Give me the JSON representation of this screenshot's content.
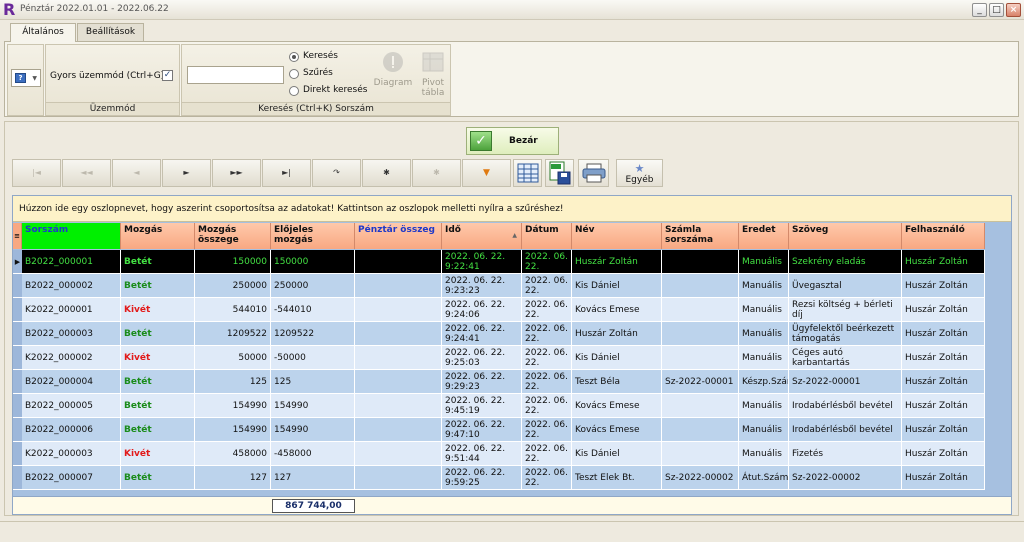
{
  "window": {
    "title": "Pénztár 2022.01.01 - 2022.06.22",
    "logo": "R"
  },
  "tabs": [
    {
      "label": "Általános",
      "active": true
    },
    {
      "label": "Beállítások",
      "active": false
    }
  ],
  "ribbon": {
    "mode_group": {
      "fast_mode_label": "Gyors üzemmód (Ctrl+G)",
      "fast_mode_checked": true,
      "caption": "Üzemmód"
    },
    "search_group": {
      "caption": "Keresés (Ctrl+K) Sorszám",
      "search_value": "",
      "options": [
        "Keresés",
        "Szűrés",
        "Direkt keresés"
      ],
      "selected_option": "Keresés",
      "diagram_label": "Diagram",
      "pivot_label_1": "Pivot",
      "pivot_label_2": "tábla"
    }
  },
  "close_button": {
    "label": "Bezár"
  },
  "toolbar": {
    "other_label": "Egyéb"
  },
  "grid": {
    "group_hint": "Húzzon ide egy oszlopnevet, hogy aszerint csoportosítsa az adatokat! Kattintson az oszlopok melletti nyílra a szűréshez!",
    "headers": [
      "Sorszám",
      "Mozgás",
      "Mozgás összege",
      "Előjeles mozgás",
      "Pénztár összeg",
      "Idő",
      "Dátum",
      "Név",
      "Számla sorszáma",
      "Eredet",
      "Szöveg",
      "Felhasználó"
    ],
    "rows": [
      {
        "sorszam": "B2022_000001",
        "mozgas": "Betét",
        "osszeg": "150000",
        "elojeles": "150000",
        "penztar": "",
        "ido": "2022. 06. 22. 9:22:41",
        "datum": "2022. 06. 22.",
        "nev": "Huszár Zoltán",
        "szamla": "",
        "eredet": "Manuális",
        "szoveg": "Szekrény eladás",
        "felhasznalo": "Huszár Zoltán"
      },
      {
        "sorszam": "B2022_000002",
        "mozgas": "Betét",
        "osszeg": "250000",
        "elojeles": "250000",
        "penztar": "",
        "ido": "2022. 06. 22. 9:23:23",
        "datum": "2022. 06. 22.",
        "nev": "Kis Dániel",
        "szamla": "",
        "eredet": "Manuális",
        "szoveg": "Üvegasztal",
        "felhasznalo": "Huszár Zoltán"
      },
      {
        "sorszam": "K2022_000001",
        "mozgas": "Kivét",
        "osszeg": "544010",
        "elojeles": "-544010",
        "penztar": "",
        "ido": "2022. 06. 22. 9:24:06",
        "datum": "2022. 06. 22.",
        "nev": "Kovács Emese",
        "szamla": "",
        "eredet": "Manuális",
        "szoveg": "Rezsi költség + bérleti díj",
        "felhasznalo": "Huszár Zoltán"
      },
      {
        "sorszam": "B2022_000003",
        "mozgas": "Betét",
        "osszeg": "1209522",
        "elojeles": "1209522",
        "penztar": "",
        "ido": "2022. 06. 22. 9:24:41",
        "datum": "2022. 06. 22.",
        "nev": "Huszár Zoltán",
        "szamla": "",
        "eredet": "Manuális",
        "szoveg": "Ügyfelektől beérkezett támogatás",
        "felhasznalo": "Huszár Zoltán"
      },
      {
        "sorszam": "K2022_000002",
        "mozgas": "Kivét",
        "osszeg": "50000",
        "elojeles": "-50000",
        "penztar": "",
        "ido": "2022. 06. 22. 9:25:03",
        "datum": "2022. 06. 22.",
        "nev": "Kis Dániel",
        "szamla": "",
        "eredet": "Manuális",
        "szoveg": "Céges autó karbantartás",
        "felhasznalo": "Huszár Zoltán"
      },
      {
        "sorszam": "B2022_000004",
        "mozgas": "Betét",
        "osszeg": "125",
        "elojeles": "125",
        "penztar": "",
        "ido": "2022. 06. 22. 9:29:23",
        "datum": "2022. 06. 22.",
        "nev": "Teszt Béla",
        "szamla": "Sz-2022-00001",
        "eredet": "Készp.Számla",
        "szoveg": "Sz-2022-00001",
        "felhasznalo": "Huszár Zoltán"
      },
      {
        "sorszam": "B2022_000005",
        "mozgas": "Betét",
        "osszeg": "154990",
        "elojeles": "154990",
        "penztar": "",
        "ido": "2022. 06. 22. 9:45:19",
        "datum": "2022. 06. 22.",
        "nev": "Kovács Emese",
        "szamla": "",
        "eredet": "Manuális",
        "szoveg": "Irodabérlésből bevétel",
        "felhasznalo": "Huszár Zoltán"
      },
      {
        "sorszam": "B2022_000006",
        "mozgas": "Betét",
        "osszeg": "154990",
        "elojeles": "154990",
        "penztar": "",
        "ido": "2022. 06. 22. 9:47:10",
        "datum": "2022. 06. 22.",
        "nev": "Kovács Emese",
        "szamla": "",
        "eredet": "Manuális",
        "szoveg": "Irodabérlésből bevétel",
        "felhasznalo": "Huszár Zoltán"
      },
      {
        "sorszam": "K2022_000003",
        "mozgas": "Kivét",
        "osszeg": "458000",
        "elojeles": "-458000",
        "penztar": "",
        "ido": "2022. 06. 22. 9:51:44",
        "datum": "2022. 06. 22.",
        "nev": "Kis Dániel",
        "szamla": "",
        "eredet": "Manuális",
        "szoveg": "Fizetés",
        "felhasznalo": "Huszár Zoltán"
      },
      {
        "sorszam": "B2022_000007",
        "mozgas": "Betét",
        "osszeg": "127",
        "elojeles": "127",
        "penztar": "",
        "ido": "2022. 06. 22. 9:59:25",
        "datum": "2022. 06. 22.",
        "nev": "Teszt Elek Bt.",
        "szamla": "Sz-2022-00002",
        "eredet": "Átut.Számla",
        "szoveg": "Sz-2022-00002",
        "felhasznalo": "Huszár Zoltán"
      }
    ],
    "footer_total": "867 744,00"
  },
  "colors": {
    "header_bg": "#f8a882",
    "row_odd": "#dfeaf8",
    "row_even": "#bcd3ec",
    "betet": "#1a8c1a",
    "kivet": "#e21a1a"
  }
}
